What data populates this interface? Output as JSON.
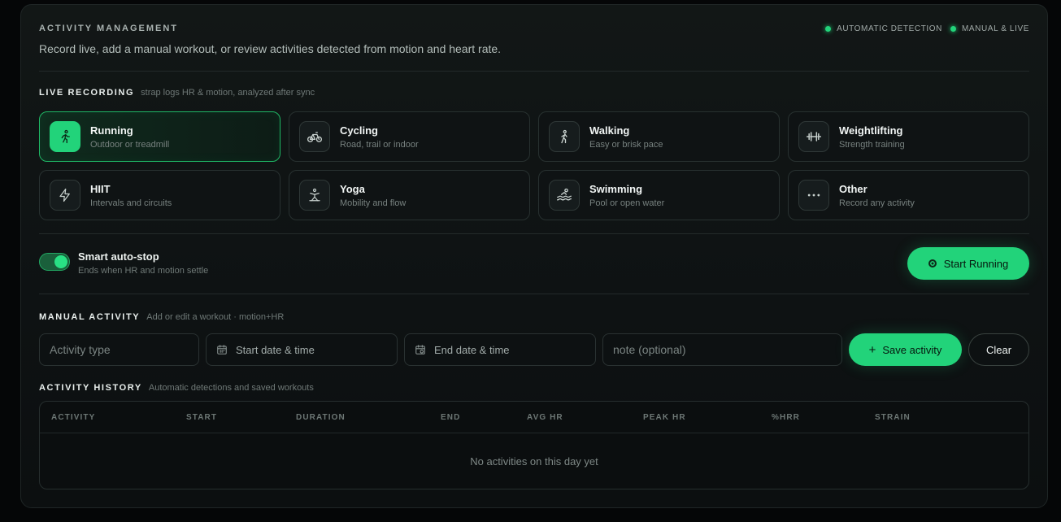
{
  "header": {
    "title": "ACTIVITY MANAGEMENT",
    "subtitle": "Record live, add a manual workout, or review activities detected from motion and heart rate.",
    "legend": [
      "AUTOMATIC DETECTION",
      "MANUAL & LIVE"
    ],
    "accent_color": "#22d37a"
  },
  "live": {
    "title": "LIVE RECORDING",
    "hint": "strap logs HR & motion, analyzed after sync",
    "activities": [
      {
        "name": "Running",
        "desc": "Outdoor or treadmill",
        "icon": "running-icon",
        "selected": true
      },
      {
        "name": "Cycling",
        "desc": "Road, trail or indoor",
        "icon": "bicycle-icon",
        "selected": false
      },
      {
        "name": "Walking",
        "desc": "Easy or brisk pace",
        "icon": "walking-icon",
        "selected": false
      },
      {
        "name": "Weightlifting",
        "desc": "Strength training",
        "icon": "dumbbell-icon",
        "selected": false
      },
      {
        "name": "HIIT",
        "desc": "Intervals and circuits",
        "icon": "lightning-icon",
        "selected": false
      },
      {
        "name": "Yoga",
        "desc": "Mobility and flow",
        "icon": "yoga-icon",
        "selected": false
      },
      {
        "name": "Swimming",
        "desc": "Pool or open water",
        "icon": "waves-icon",
        "selected": false
      },
      {
        "name": "Other",
        "desc": "Record any activity",
        "icon": "more-icon",
        "selected": false
      }
    ],
    "auto_stop": {
      "label": "Smart auto-stop",
      "hint": "Ends when HR and motion settle",
      "enabled": true
    },
    "start_button": "Start Running"
  },
  "manual": {
    "title": "MANUAL ACTIVITY",
    "hint": "Add or edit a workout · motion+HR",
    "type_placeholder": "Activity type",
    "start_placeholder": "Start date & time",
    "end_placeholder": "End date & time",
    "note_placeholder": "note (optional)",
    "save_button": "Save activity",
    "clear_button": "Clear"
  },
  "history": {
    "title": "ACTIVITY HISTORY",
    "hint": "Automatic detections and saved workouts",
    "columns": [
      "ACTIVITY",
      "START",
      "DURATION",
      "END",
      "AVG HR",
      "PEAK HR",
      "%HRR",
      "STRAIN"
    ],
    "empty_text": "No activities on this day yet"
  }
}
